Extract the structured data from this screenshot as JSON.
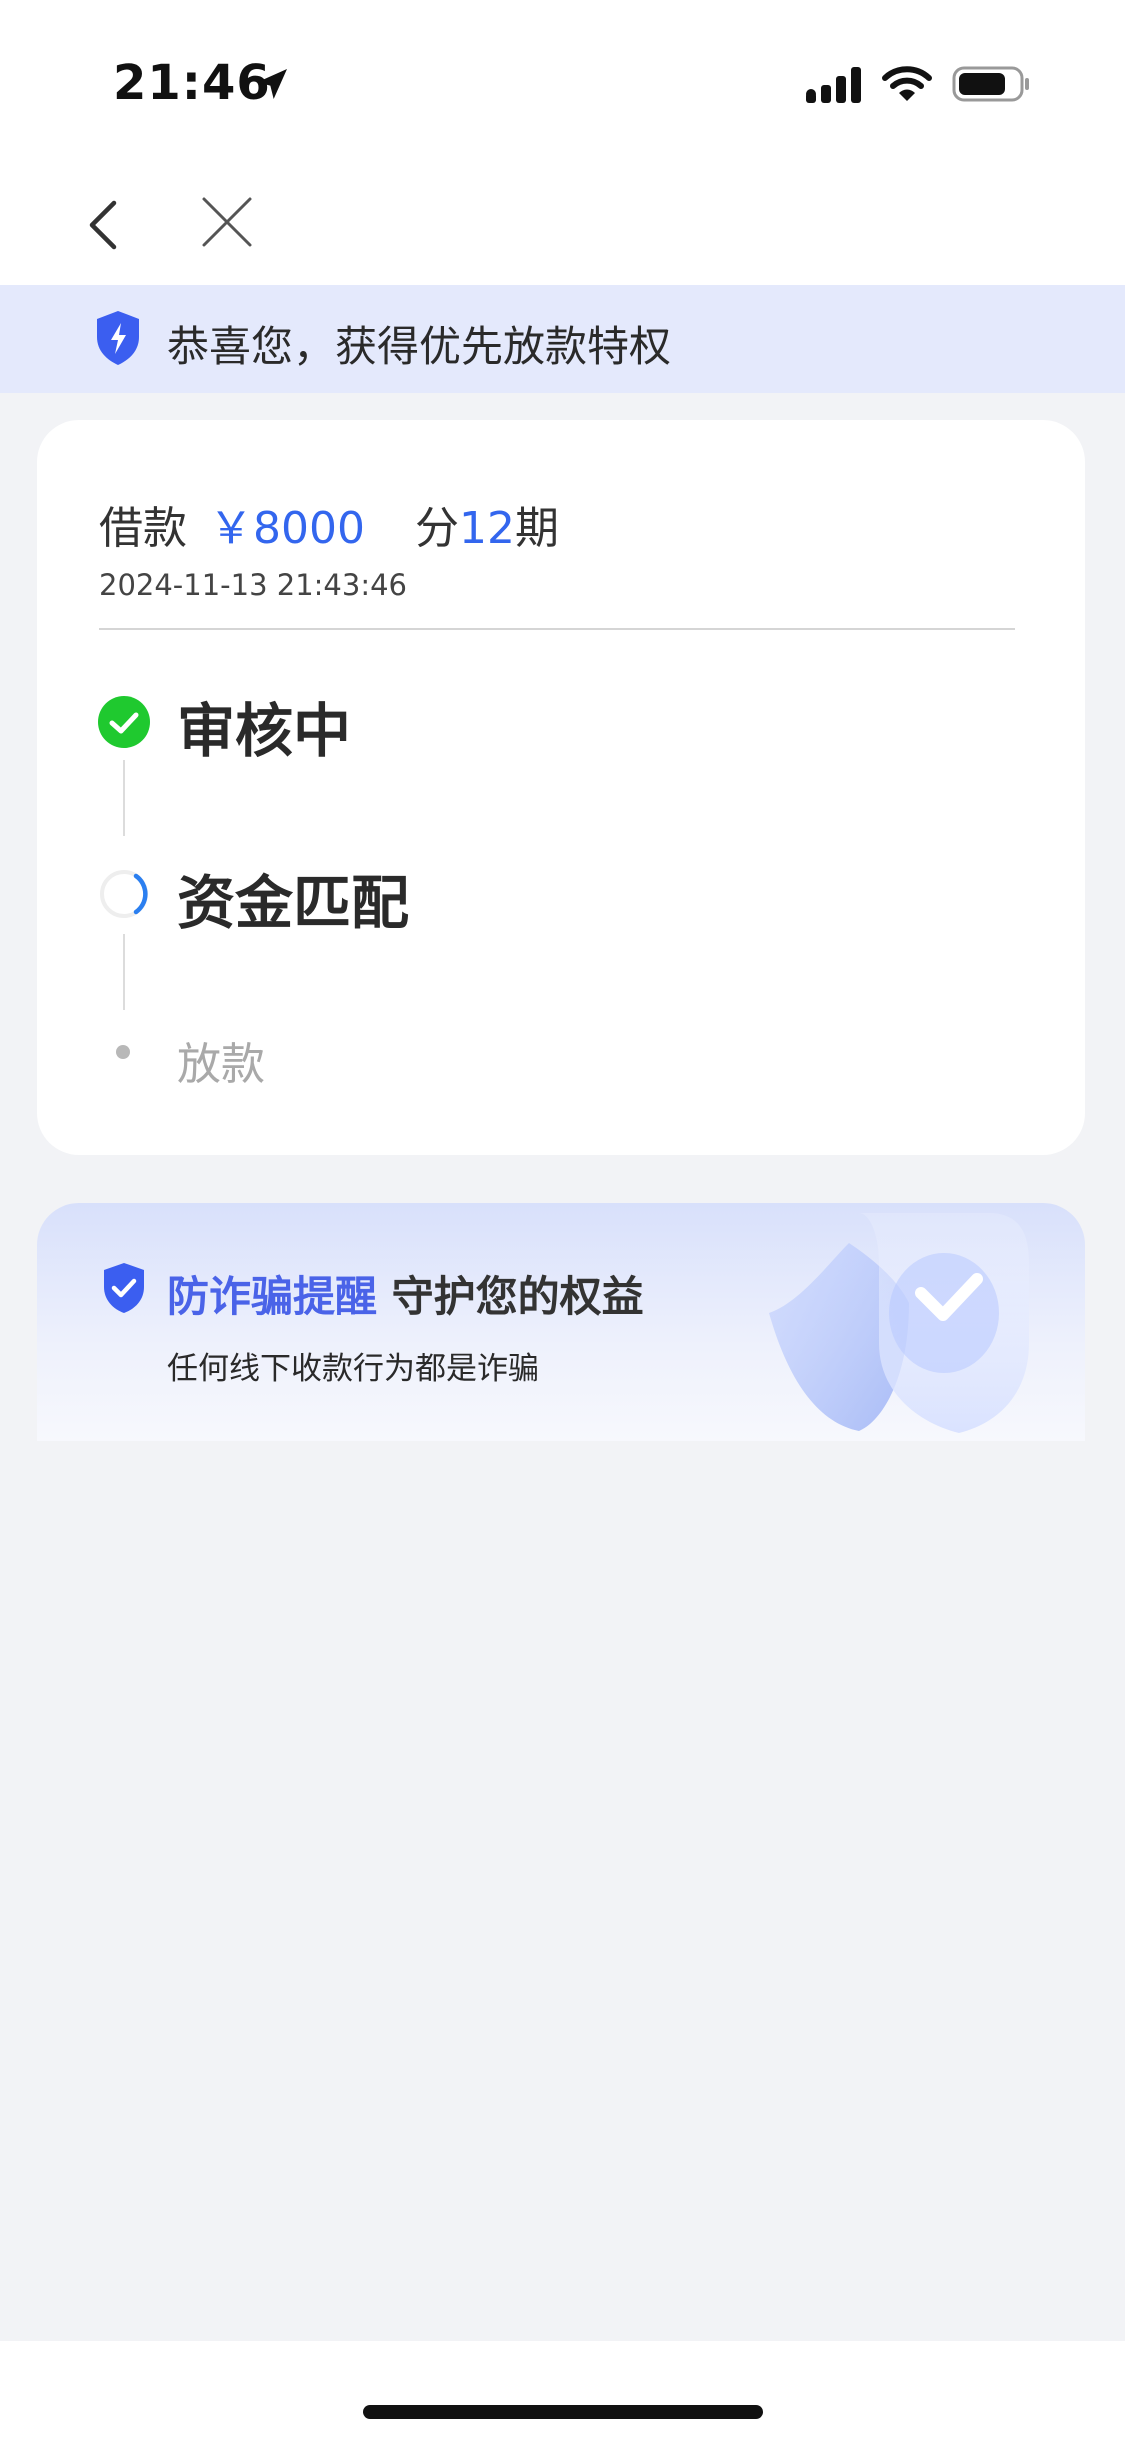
{
  "status_bar": {
    "time": "21:46",
    "icons": [
      "location-arrow-icon",
      "cellular-signal-icon",
      "wifi-icon",
      "battery-icon"
    ]
  },
  "nav": {
    "icons": [
      "chevron-left-icon",
      "close-icon"
    ]
  },
  "banner": {
    "text": "恭喜您，获得优先放款特权",
    "icon": "lightning-shield-icon",
    "color": "#e4e9fc",
    "icon_color": "#3b5ef0"
  },
  "loan": {
    "label": "借款",
    "amount": "￥8000",
    "period_prefix": "分",
    "period_count": "12",
    "period_suffix": "期",
    "date": "2024-11-13 21:43:46",
    "accent_color": "#3366ee"
  },
  "steps": [
    {
      "label": "审核中",
      "state": "done",
      "icon": "check-circle-icon",
      "color": "#1fc92f"
    },
    {
      "label": "资金匹配",
      "state": "in_progress",
      "icon": "loading-spinner-icon",
      "color": "#2b7ff0"
    },
    {
      "label": "放款",
      "state": "pending",
      "icon": "dot-icon",
      "color": "#b8b8b8"
    }
  ],
  "fraud_reminder": {
    "title_highlight": "防诈骗提醒",
    "title_rest": "守护您的权益",
    "subtitle": "任何线下收款行为都是诈骗",
    "icon": "shield-check-icon",
    "decoration": "shield-check-illustration"
  }
}
